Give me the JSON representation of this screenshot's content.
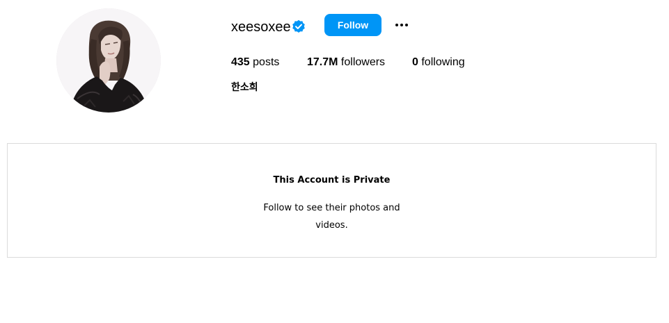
{
  "profile": {
    "username": "xeesoxee",
    "verified_icon": "verified-badge-icon",
    "follow_label": "Follow",
    "more_icon": "more-options-icon",
    "full_name": "한소희",
    "accent_color": "#0095f6"
  },
  "stats": {
    "posts_count": "435",
    "posts_label": "posts",
    "followers_count": "17.7M",
    "followers_label": "followers",
    "following_count": "0",
    "following_label": "following"
  },
  "private_notice": {
    "title": "This Account is Private",
    "text": "Follow to see their photos and videos."
  }
}
